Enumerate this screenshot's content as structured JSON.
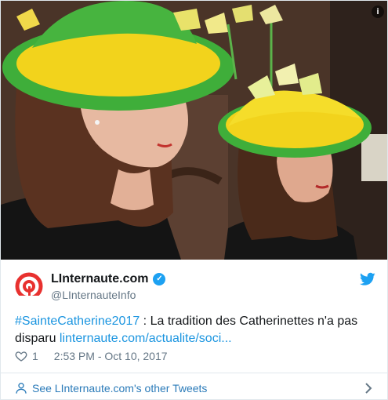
{
  "photo": {
    "description_icon": "info-icon",
    "info_label": "i"
  },
  "author": {
    "name": "LInternaute.com",
    "handle": "@LInternauteInfo",
    "verified": true,
    "avatar_icon": "linternaute-logo",
    "brand_color": "#e8312f"
  },
  "tweet": {
    "hashtag": "#SainteCatherine2017",
    "text": " : La tradition des Catherinettes n'a pas disparu ",
    "link": "linternaute.com/actualite/soci..."
  },
  "meta": {
    "likes": "1",
    "timestamp": "2:53 PM - Oct 10, 2017"
  },
  "footer": {
    "label": "See LInternaute.com's other Tweets"
  },
  "colors": {
    "link": "#1b95e0",
    "twitter_blue": "#1da1f2",
    "muted": "#657786",
    "hat_green": "#3fae3a",
    "hat_yellow": "#f2d31c"
  }
}
